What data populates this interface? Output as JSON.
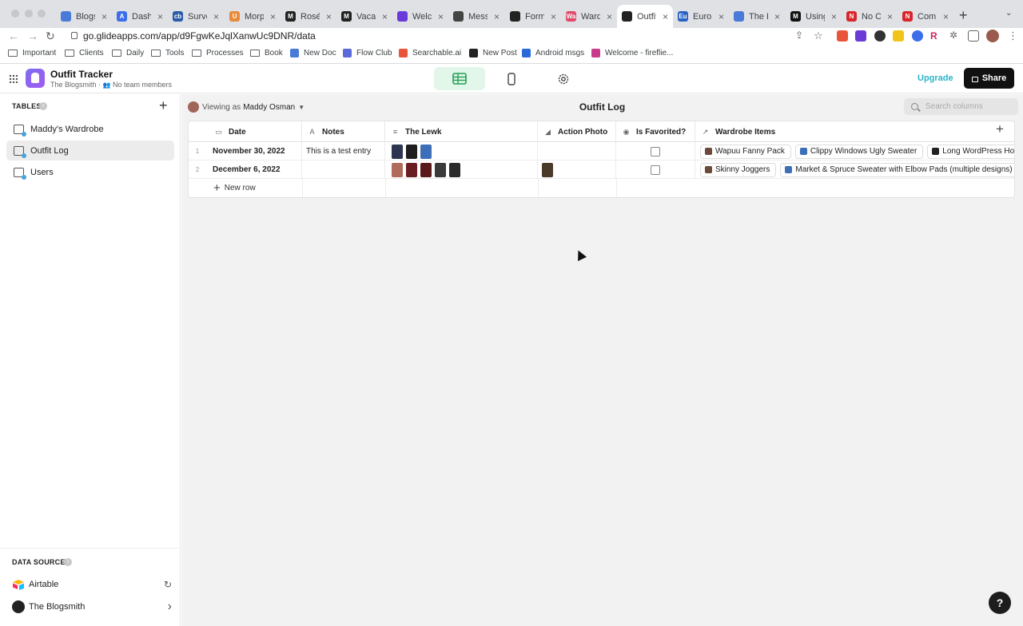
{
  "browser": {
    "tabs": [
      {
        "title": "Blogs",
        "color": "#4a7ad8",
        "letter": ""
      },
      {
        "title": "Dashb",
        "color": "#3b6ee8",
        "letter": "A"
      },
      {
        "title": "Surve",
        "color": "#2b5ba9",
        "letter": "cb"
      },
      {
        "title": "Morph",
        "color": "#e8893b",
        "letter": "U"
      },
      {
        "title": "Rosé",
        "color": "#222222",
        "letter": "M"
      },
      {
        "title": "Vacay",
        "color": "#222222",
        "letter": "M"
      },
      {
        "title": "Welco",
        "color": "#6a3bd8",
        "letter": ""
      },
      {
        "title": "Messa",
        "color": "#444444",
        "letter": ""
      },
      {
        "title": "Form",
        "color": "#222222",
        "letter": ""
      },
      {
        "title": "Wardr",
        "color": "#e04a6a",
        "letter": "Wa"
      },
      {
        "title": "Outfit",
        "color": "#222222",
        "letter": ""
      },
      {
        "title": "Euro",
        "color": "#2a62c4",
        "letter": "Eu"
      },
      {
        "title": "The B",
        "color": "#4a7ad8",
        "letter": ""
      },
      {
        "title": "Using",
        "color": "#111111",
        "letter": "M"
      },
      {
        "title": "No Co",
        "color": "#d8262b",
        "letter": "N"
      },
      {
        "title": "Comm",
        "color": "#d8262b",
        "letter": "N"
      }
    ],
    "active_tab_index": 10,
    "url": "go.glideapps.com/app/d9FgwKeJqlXanwUc9DNR/data",
    "bookmarks": [
      {
        "label": "Important",
        "type": "folder"
      },
      {
        "label": "Clients",
        "type": "folder"
      },
      {
        "label": "Daily",
        "type": "folder"
      },
      {
        "label": "Tools",
        "type": "folder"
      },
      {
        "label": "Processes",
        "type": "folder"
      },
      {
        "label": "Book",
        "type": "folder"
      },
      {
        "label": "New Doc",
        "type": "site",
        "color": "#4a7ad8"
      },
      {
        "label": "Flow Club",
        "type": "site",
        "color": "#5a6ad8"
      },
      {
        "label": "Searchable.ai",
        "type": "site",
        "color": "#e8553b"
      },
      {
        "label": "New Post",
        "type": "site",
        "color": "#222222"
      },
      {
        "label": "Android msgs",
        "type": "site",
        "color": "#2a6ad8"
      },
      {
        "label": "Welcome - fireflie...",
        "type": "site",
        "color": "#c83b8a"
      }
    ]
  },
  "app": {
    "title": "Outfit Tracker",
    "org": "The Blogsmith",
    "members": "No team members",
    "upgrade_label": "Upgrade",
    "share_label": "Share",
    "accent": "#2bb5c9"
  },
  "sidebar": {
    "tables_heading": "TABLES",
    "tables": [
      {
        "label": "Maddy's Wardrobe",
        "active": false
      },
      {
        "label": "Outfit Log",
        "active": true
      },
      {
        "label": "Users",
        "active": false
      }
    ],
    "sources_heading": "DATA SOURCES",
    "sources": [
      {
        "label": "Airtable",
        "action": "↻"
      },
      {
        "label": "The Blogsmith",
        "action": "›"
      }
    ]
  },
  "main": {
    "viewing_prefix": "Viewing as",
    "viewing_user": "Maddy Osman",
    "table_title": "Outfit Log",
    "search_placeholder": "Search columns",
    "columns": [
      {
        "label": "Date",
        "icon": "calendar-icon"
      },
      {
        "label": "Notes",
        "icon": "text-icon"
      },
      {
        "label": "The Lewk",
        "icon": "list-icon"
      },
      {
        "label": "Action Photo",
        "icon": "image-icon"
      },
      {
        "label": "Is Favorited?",
        "icon": "toggle-icon"
      },
      {
        "label": "Wardrobe Items",
        "icon": "relation-icon"
      }
    ],
    "rows": [
      {
        "num": "1",
        "date": "November 30, 2022",
        "notes": "This is a test entry",
        "lewk": [
          "#2d3550",
          "#1e1e1e",
          "#3c6fb8"
        ],
        "photo": null,
        "favorited": false,
        "items": [
          "Wapuu Fanny Pack",
          "Clippy Windows Ugly Sweater",
          "Long WordPress Hoodie"
        ]
      },
      {
        "num": "2",
        "date": "December 6, 2022",
        "notes": "",
        "lewk": [
          "#b06c5a",
          "#6a1e22",
          "#5a1a1c",
          "#3a3a3a",
          "#2a2a2a"
        ],
        "photo": "#4a3a2a",
        "favorited": false,
        "items": [
          "Skinny Joggers",
          "Market & Spruce Sweater with Elbow Pads (multiple designs)"
        ]
      }
    ],
    "new_row_label": "New row"
  }
}
